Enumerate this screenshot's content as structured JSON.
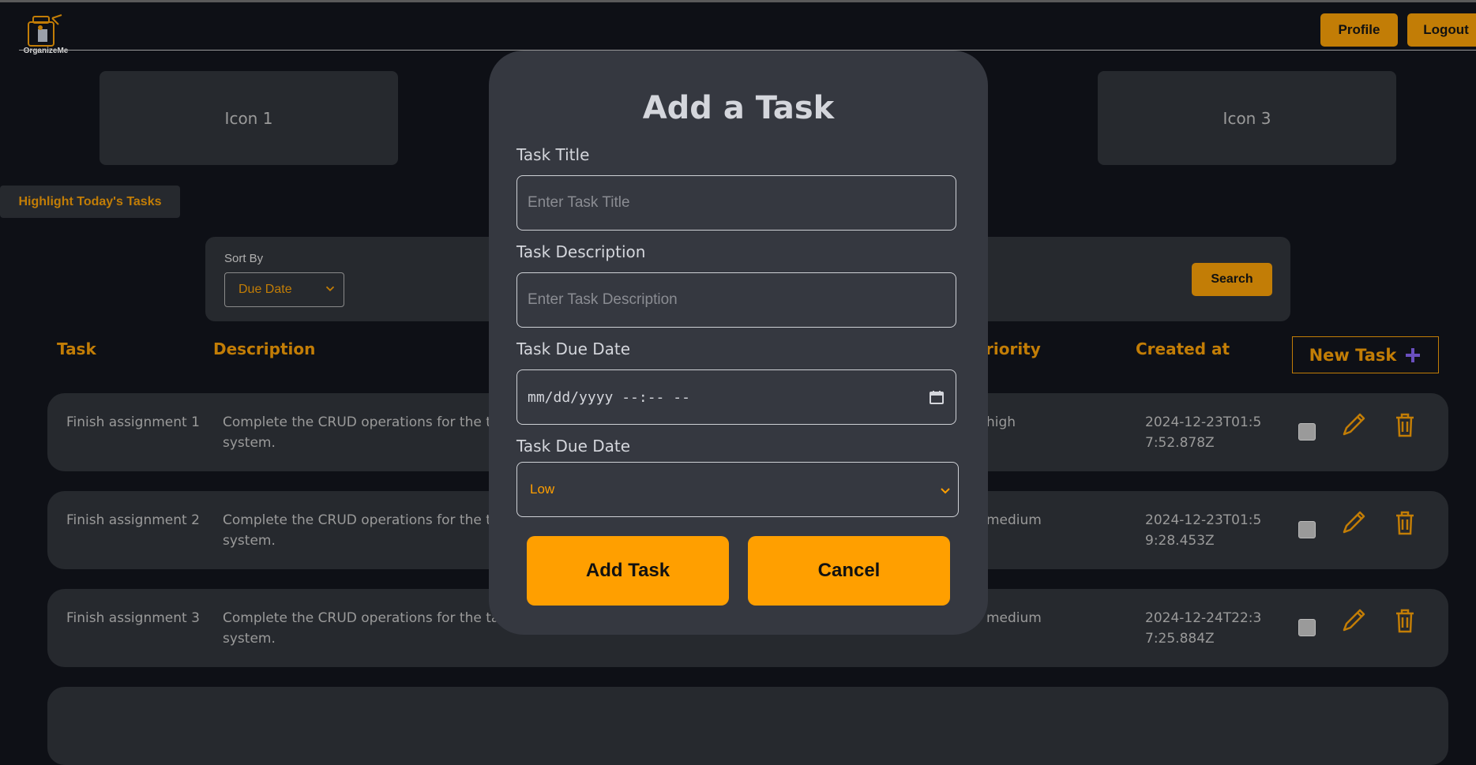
{
  "app": {
    "logo_text": "OrganizeMe"
  },
  "nav": {
    "profile_label": "Profile",
    "logout_label": "Logout"
  },
  "cards": {
    "card1": "Icon 1",
    "card3": "Icon 3"
  },
  "highlight_label": "Highlight Today's Tasks",
  "filter": {
    "sort_label": "Sort By",
    "sort_value": "Due Date",
    "search_label": "Search"
  },
  "table": {
    "headers": {
      "task": "Task",
      "description": "Description",
      "priority": "riority",
      "created": "Created at"
    },
    "new_task_label": "New Task",
    "rows": [
      {
        "task": "Finish assignment 1",
        "description": "Complete the CRUD operations for the ta",
        "description2": "system.",
        "priority": "high",
        "created": "2024-12-23T01:57:52.878Z"
      },
      {
        "task": "Finish assignment 2",
        "description": "Complete the CRUD operations for the ta",
        "description2": "system.",
        "priority": "medium",
        "created": "2024-12-23T01:59:28.453Z"
      },
      {
        "task": "Finish assignment 3",
        "description": "Complete the CRUD operations for the ta",
        "description2": "system.",
        "priority": "medium",
        "created": "2024-12-24T22:37:25.884Z"
      }
    ]
  },
  "modal": {
    "title": "Add a Task",
    "title_label": "Task Title",
    "title_placeholder": "Enter Task Title",
    "desc_label": "Task Description",
    "desc_placeholder": "Enter Task Description",
    "due_label": "Task Due Date",
    "due_value": "mm/dd/yyyy --:-- --",
    "priority_label": "Task Due Date",
    "priority_value": "Low",
    "add_label": "Add Task",
    "cancel_label": "Cancel"
  },
  "colors": {
    "accent": "#c27d06",
    "accent_bright": "#ff9f00",
    "bg": "#0e1016",
    "panel": "#26292e",
    "modal": "#353840",
    "plus": "#6a4fbf"
  }
}
